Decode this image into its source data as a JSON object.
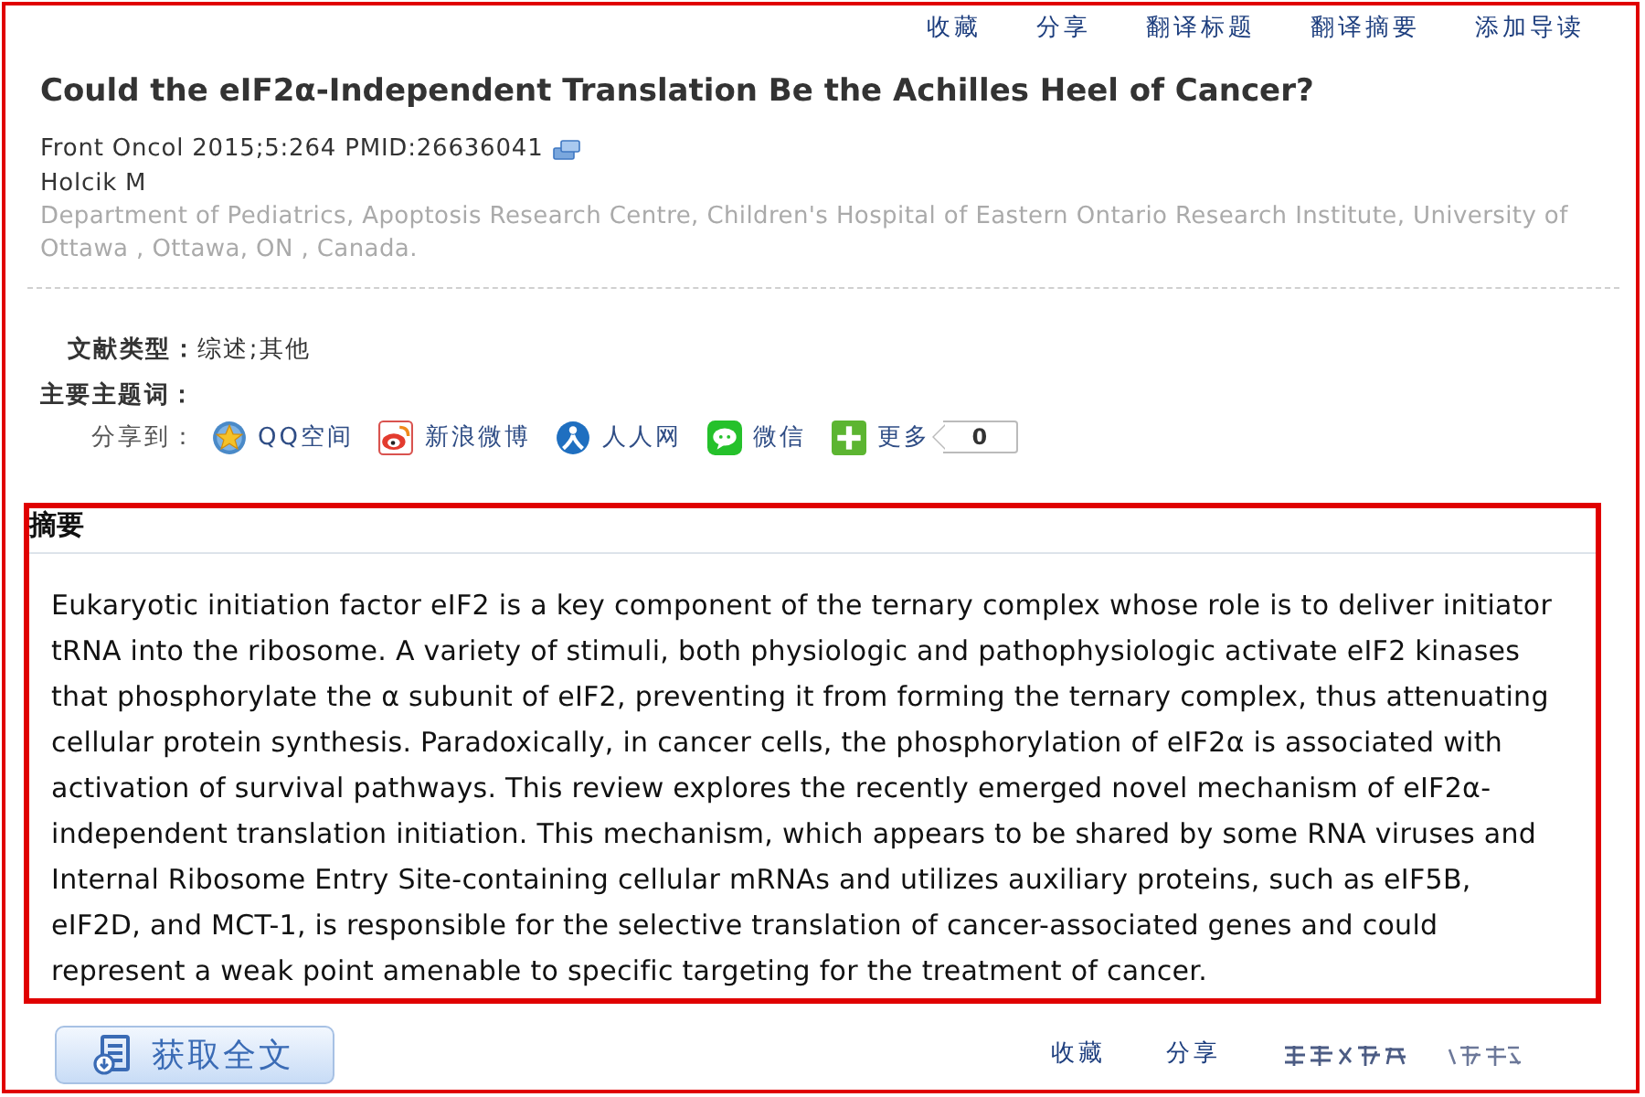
{
  "top_links": [
    "收藏",
    "分享",
    "翻译标题",
    "翻译摘要",
    "添加导读"
  ],
  "article": {
    "title": "Could the eIF2α-Independent Translation Be the Achilles Heel of Cancer?",
    "citation": "Front Oncol 2015;5:264 PMID:26636041",
    "author": "Holcik M",
    "affiliation": "Department of Pediatrics, Apoptosis Research Centre, Children's Hospital of Eastern Ontario Research Institute, University of Ottawa , Ottawa, ON , Canada."
  },
  "meta": {
    "doc_type_label": "文献类型：",
    "doc_type_value": "综述;其他",
    "subject_label": "主要主题词："
  },
  "share": {
    "label": "分享到：",
    "items": [
      {
        "kind": "qzone",
        "label": "QQ空间"
      },
      {
        "kind": "weibo",
        "label": "新浪微博"
      },
      {
        "kind": "renren",
        "label": "人人网"
      },
      {
        "kind": "wechat",
        "label": "微信"
      },
      {
        "kind": "more",
        "label": "更多"
      }
    ],
    "count": "0"
  },
  "abstract": {
    "heading": "摘要",
    "text": "Eukaryotic initiation factor eIF2 is a key component of the ternary complex whose role is to deliver initiator tRNA into the ribosome. A variety of stimuli, both physiologic and pathophysiologic activate eIF2 kinases that phosphorylate the α subunit of eIF2, preventing it from forming the ternary complex, thus attenuating cellular protein synthesis. Paradoxically, in cancer cells, the phosphorylation of eIF2α is associated with activation of survival pathways. This review explores the recently emerged novel mechanism of eIF2α-independent translation initiation. This mechanism, which appears to be shared by some RNA viruses and Internal Ribosome Entry Site-containing cellular mRNAs and utilizes auxiliary proteins, such as eIF5B, eIF2D, and MCT-1, is responsible for the selective translation of cancer-associated genes and could represent a weak point amenable to specific targeting for the treatment of cancer."
  },
  "bottom": {
    "button": "获取全文",
    "links": [
      "收藏",
      "分享"
    ]
  }
}
